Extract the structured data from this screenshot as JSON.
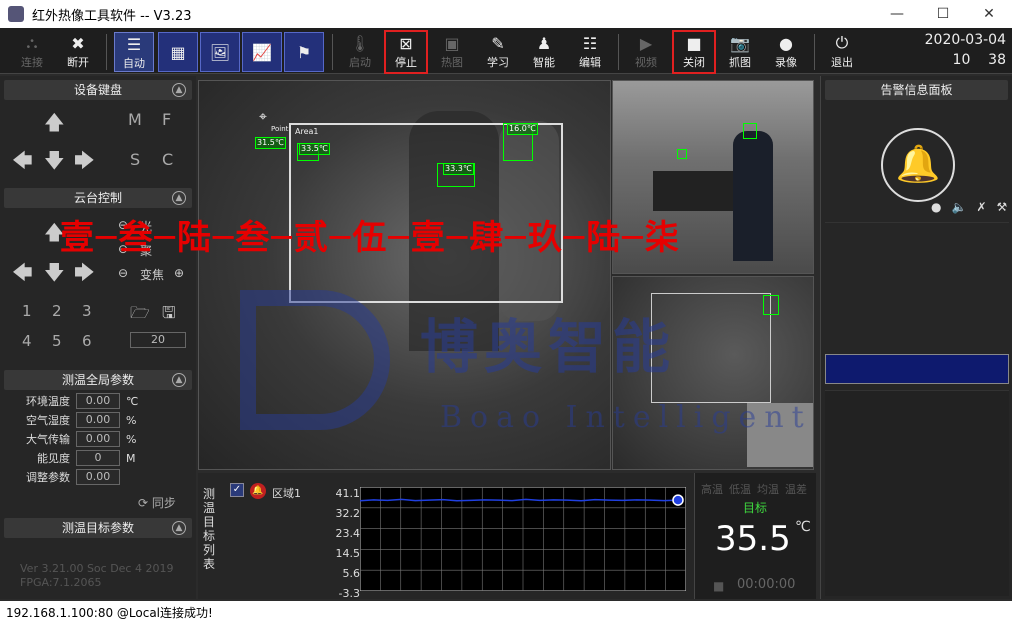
{
  "window": {
    "title": "红外热像工具软件 -- V3.23",
    "minimize": "—",
    "maximize": "☐",
    "close": "✕"
  },
  "toolbar": {
    "connect": "连接",
    "disconnect": "断开",
    "auto": "自动",
    "start": "启动",
    "stop": "停止",
    "thermal": "热图",
    "learn": "学习",
    "smart": "智能",
    "edit": "编辑",
    "video": "视频",
    "off": "关闭",
    "capture": "抓图",
    "record": "录像",
    "exit": "退出"
  },
  "datetime": {
    "date": "2020-03-04",
    "hour": "10",
    "minute": "38"
  },
  "left": {
    "keyboard_title": "设备键盘",
    "key_m": "M",
    "key_f": "F",
    "key_s": "S",
    "key_c": "C",
    "ptz_title": "云台控制",
    "zoom_label": "变焦",
    "light_label": "光",
    "focus_label": "聚",
    "presets": [
      "1",
      "2",
      "3",
      "4",
      "5",
      "6"
    ],
    "preset_value": "20",
    "global_title": "测温全局参数",
    "params": [
      {
        "label": "环境温度",
        "value": "0.00",
        "unit": "℃"
      },
      {
        "label": "空气湿度",
        "value": "0.00",
        "unit": "%"
      },
      {
        "label": "大气传输",
        "value": "0.00",
        "unit": "%"
      },
      {
        "label": "能见度",
        "value": "0",
        "unit": "M"
      },
      {
        "label": "调整参数",
        "value": "0.00",
        "unit": ""
      }
    ],
    "sync": "同步",
    "target_title": "测温目标参数",
    "version_line1": "Ver 3.21.00 Soc Dec  4 2019",
    "version_line2": "FPGA:7.1.2065"
  },
  "main": {
    "point_label": "Point",
    "area_label": "Area1",
    "tags": [
      "31.5℃",
      "33.5℃",
      "33.3℃",
      "16.0℃"
    ]
  },
  "watermark": {
    "red_text": "壹─叁─陆─叁─贰─伍─壹─肆─玖─陆─柒",
    "company": "博奥智能",
    "company_en": "Boao Intelligent"
  },
  "bottom": {
    "list_label": "测温目标列表",
    "region": "区域1",
    "yticks": [
      "41.1",
      "32.2",
      "23.4",
      "14.5",
      "5.6",
      "-3.3"
    ],
    "tabs": [
      "高温",
      "低温",
      "均温",
      "温差"
    ],
    "target_label": "目标",
    "temperature": "35.5",
    "temp_unit": "℃",
    "time": "00:00:00"
  },
  "alarm": {
    "title": "告警信息面板"
  },
  "status": {
    "text": "192.168.1.100:80 @Local连接成功!"
  },
  "colors": {
    "accent": "#2a3a7a",
    "highlight_red": "#e02020",
    "alarm_bar": "#0e1a6e",
    "trend_line": "#2040e0"
  },
  "chart_data": {
    "type": "line",
    "ylim": [
      -3.3,
      41.1
    ],
    "yticks": [
      41.1,
      32.2,
      23.4,
      14.5,
      5.6,
      -3.3
    ],
    "series": [
      {
        "name": "区域1",
        "values": [
          35.2,
          35.6,
          35.4,
          35.8,
          35.3,
          35.5,
          35.7,
          35.2,
          35.4,
          35.6,
          35.5,
          35.3,
          35.8,
          35.4,
          35.6,
          35.5,
          35.2,
          35.7,
          35.5,
          35.4,
          35.6,
          35.5,
          35.3,
          35.5
        ]
      }
    ]
  }
}
